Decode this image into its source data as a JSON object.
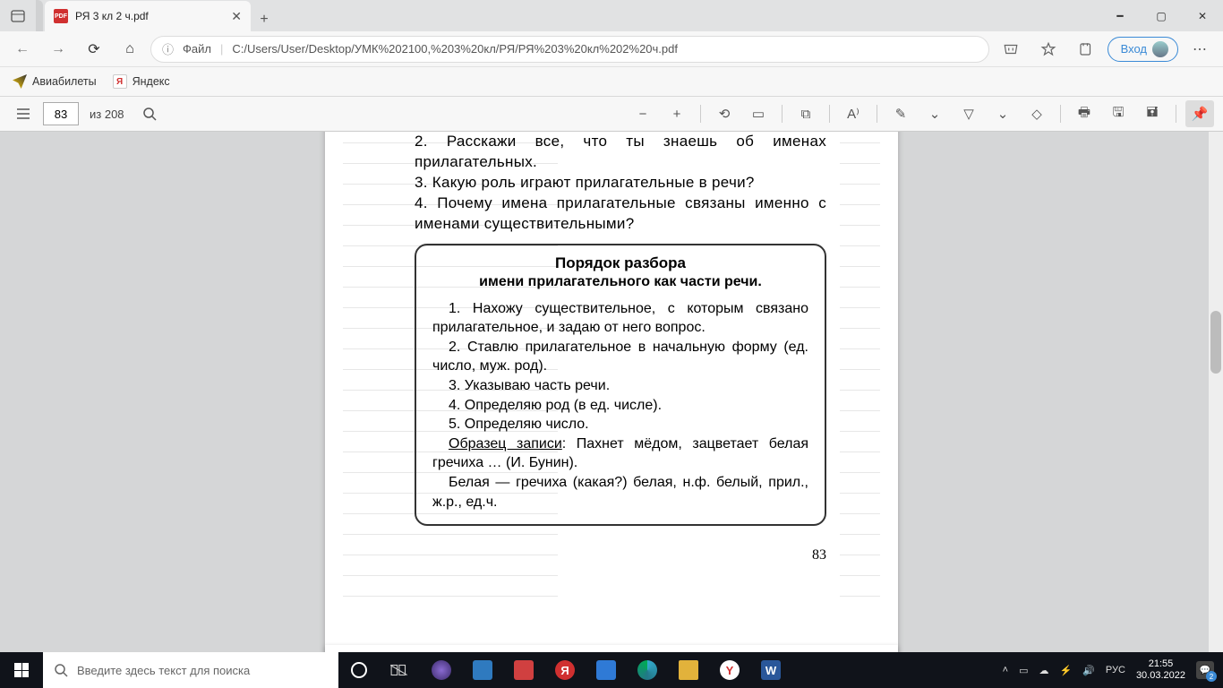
{
  "browser": {
    "tab_title": "РЯ 3 кл 2 ч.pdf",
    "addr_prefix": "Файл",
    "addr_path": "C:/Users/User/Desktop/УМК%202100,%203%20кл/РЯ/РЯ%203%20кл%202%20ч.pdf",
    "login": "Вход"
  },
  "bookmarks": {
    "avia": "Авиабилеты",
    "yandex": "Яндекс"
  },
  "pdf_toolbar": {
    "page": "83",
    "of": "из 208"
  },
  "doc": {
    "q2": "2. Расскажи все, что ты знаешь об именах прилагательных.",
    "q3": "3. Какую роль играют прилагательные в речи?",
    "q4": "4. Почему имена прилагательные связаны именно с именами существительными?",
    "box_h1": "Порядок разбора",
    "box_h2": "имени прилагательного как части речи.",
    "b1": "1. Нахожу существительное, с которым связано прилагательное, и задаю от него вопрос.",
    "b2": "2. Ставлю прилагательное в начальную форму (ед. число, муж. род).",
    "b3": "3. Указываю часть речи.",
    "b4": "4. Определяю род (в ед. числе).",
    "b5": "5. Определяю число.",
    "sample_label": "Образец записи",
    "sample_rest": ": Пахнет мёдом, зацветает белая гречиха … (И. Бунин).",
    "sample2": "Белая — гречиха (какая?) белая, н.ф. белый, прил., ж.р., ед.ч.",
    "pagenum": "83"
  },
  "taskbar": {
    "search_placeholder": "Введите здесь текст для поиска",
    "lang": "РУС",
    "time": "21:55",
    "date": "30.03.2022"
  }
}
